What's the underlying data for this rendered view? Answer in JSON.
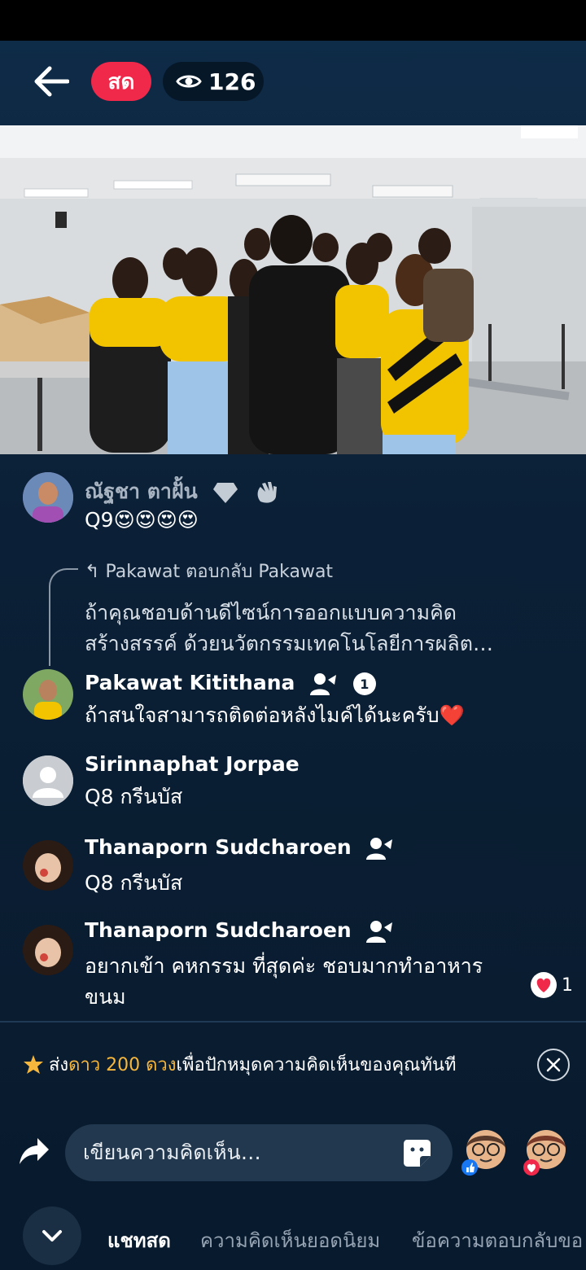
{
  "header": {
    "live_label": "สด",
    "viewer_count": "126"
  },
  "comments": [
    {
      "name": "ณัฐชา ตาฝั้น",
      "text": "Q9😍😍😍😍"
    },
    {
      "reply_label": "Pakawat ตอบกลับ Pakawat",
      "reply_text_1": "ถ้าคุณชอบด้านดีไซน์การออกแบบความคิด",
      "reply_text_2": "สร้างสรรค์ ด้วยนวัตกรรมเทคโนโลยีการผลิต…",
      "name": "Pakawat Kitithana",
      "badge_number": "1",
      "text": "ถ้าสนใจสามารถติดต่อหลังไมค์ได้นะครับ❤️"
    },
    {
      "name": "Sirinnaphat Jorpae",
      "text": "Q8 กรีนบัส"
    },
    {
      "name": "Thanaporn Sudcharoen",
      "text": "Q8 กรีนบัส"
    },
    {
      "name": "Thanaporn Sudcharoen",
      "text_1": "อยากเข้า คหกรรม ที่สุดค่ะ ชอบมากทำอาหาร",
      "text_2": "ขนม",
      "reaction_count": "1"
    }
  ],
  "promo": {
    "prefix": "ส่ง",
    "highlight": "ดาว 200 ดวง",
    "suffix": "เพื่อปักหมุดความคิดเห็นของคุณทันที"
  },
  "composer": {
    "placeholder": "เขียนความคิดเห็น…"
  },
  "tabs": [
    {
      "label": "แชทสด"
    },
    {
      "label": "ความคิดเห็นยอดนิยม"
    },
    {
      "label": "ข้อความตอบกลับขอ"
    }
  ],
  "colors": {
    "live_red": "#f0284a",
    "background": "#0d2238",
    "highlight_gold": "#f6b73c"
  }
}
